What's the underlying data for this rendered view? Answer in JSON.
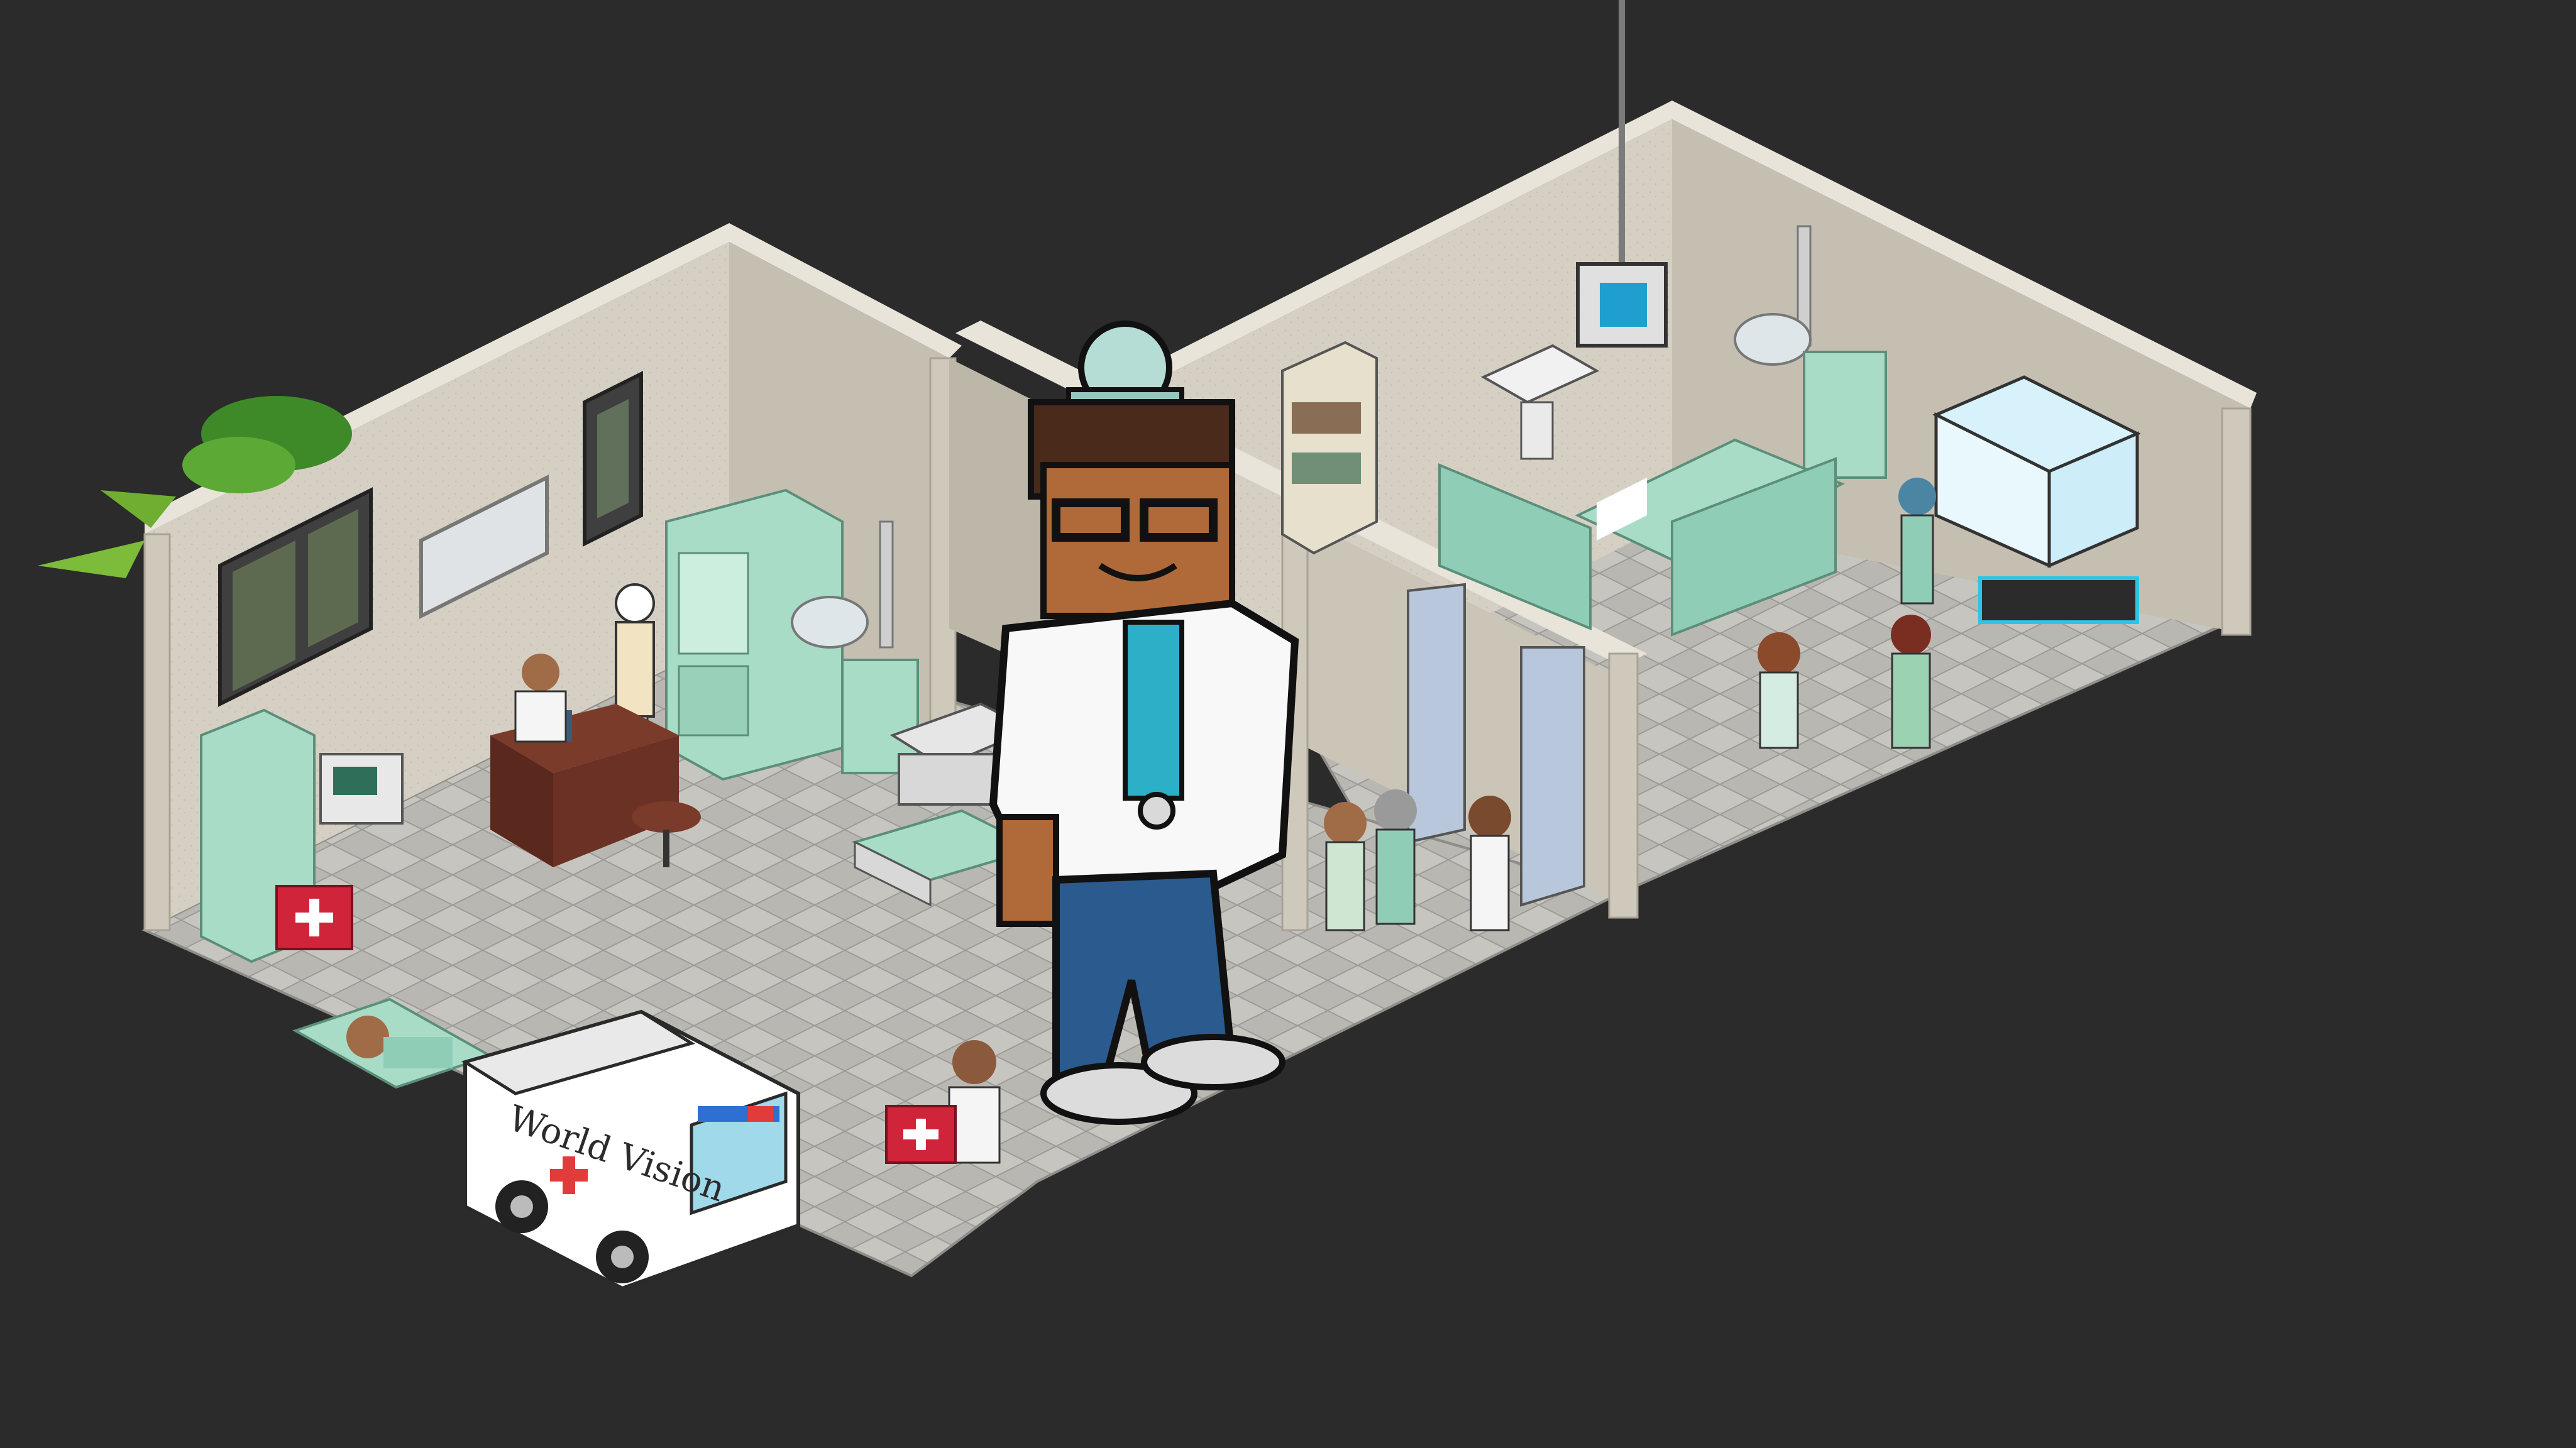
{
  "scene": {
    "background_color": "#2b2b2b",
    "floor_color": "#b8b6b2",
    "wall_color": "#d6d0c4",
    "wall_shadow_color": "#b8b2a4",
    "furniture_mint_color": "#a9dcc6",
    "curtain_color": "#8fcdb6",
    "ambulance_color": "#ffffff"
  },
  "ambulance": {
    "brand_text": "World Vision",
    "icon": "red-cross-icon"
  },
  "icons": {
    "plant": "palm-plant-icon",
    "window": "window-icon",
    "skeleton": "skeleton-model-icon",
    "first_aid_kit": "first-aid-kit-icon",
    "stool": "stool-icon",
    "monitor": "tv-monitor-icon",
    "sink": "sink-icon",
    "surgical_lamp": "surgical-lamp-icon",
    "incubator": "incubator-icon"
  }
}
